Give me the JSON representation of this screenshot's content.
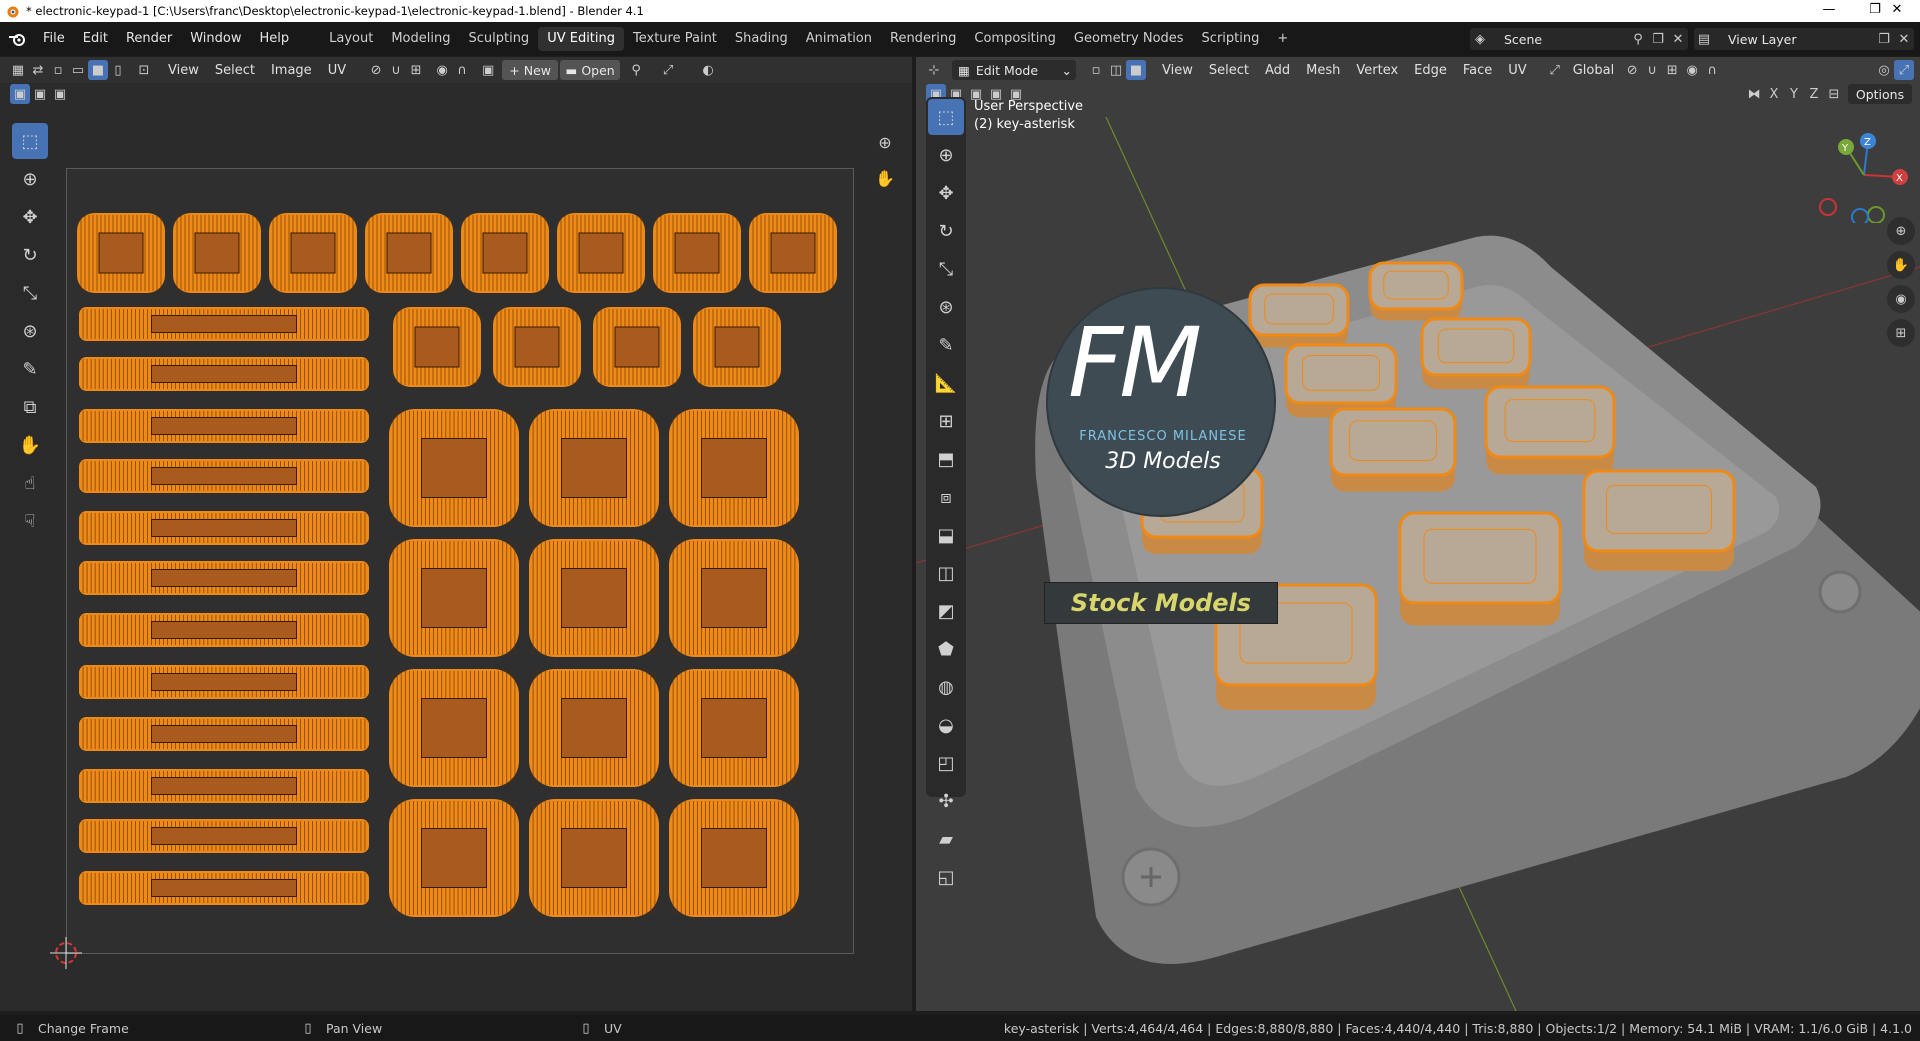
{
  "window": {
    "title": "* electronic-keypad-1 [C:\\Users\\franc\\Desktop\\electronic-keypad-1\\electronic-keypad-1.blend] - Blender 4.1",
    "minimize": "—",
    "maximize": "❐",
    "close": "✕"
  },
  "menus": [
    "File",
    "Edit",
    "Render",
    "Window",
    "Help"
  ],
  "workspaces": [
    "Layout",
    "Modeling",
    "Sculpting",
    "UV Editing",
    "Texture Paint",
    "Shading",
    "Animation",
    "Rendering",
    "Compositing",
    "Geometry Nodes",
    "Scripting"
  ],
  "active_workspace": "UV Editing",
  "add_tab": "+",
  "scene": {
    "label": "Scene"
  },
  "view_layer": {
    "label": "View Layer"
  },
  "uv_editor": {
    "menus": [
      "View",
      "Select",
      "Image",
      "UV"
    ],
    "new_button": "New",
    "open_button": "Open"
  },
  "viewport": {
    "mode": "Edit Mode",
    "menus": [
      "View",
      "Select",
      "Add",
      "Mesh",
      "Vertex",
      "Edge",
      "Face",
      "UV"
    ],
    "transform_orientation": "Global",
    "axis_labels": [
      "X",
      "Y",
      "Z"
    ],
    "options": "Options",
    "overlay_line1": "User Perspective",
    "overlay_line2": "(2) key-asterisk",
    "watermark": {
      "brand": "FM",
      "name": "FRANCESCO MILANESE",
      "subtitle": "3D Models",
      "tag": "Stock Models"
    }
  },
  "status": {
    "left": [
      {
        "icon": "mouse-left-icon",
        "label": "Change Frame"
      },
      {
        "icon": "mouse-middle-icon",
        "label": "Pan View"
      },
      {
        "icon": "mouse-right-icon",
        "label": "UV"
      }
    ],
    "stats": "key-asterisk | Verts:4,464/4,464 | Edges:8,880/8,880 | Faces:4,440/4,440 | Tris:8,880 | Objects:1/2 | Memory: 54.1 MiB | VRAM: 1.1/6.0 GiB | 4.1.0"
  },
  "colors": {
    "accent": "#4772b3",
    "uv_island": "#f08a17",
    "uv_fill": "#a85a1f",
    "mesh": "#8a8a8a",
    "background": "#3d3d3d"
  }
}
